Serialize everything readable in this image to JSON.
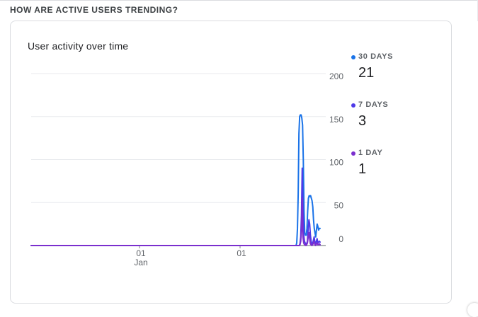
{
  "section": {
    "title": "HOW ARE ACTIVE USERS TRENDING?"
  },
  "card": {
    "title": "User activity over time"
  },
  "legend": [
    {
      "label": "30 DAYS",
      "value": "21",
      "color": "#1a73e8"
    },
    {
      "label": "7 DAYS",
      "value": "3",
      "color": "#4f3ae8"
    },
    {
      "label": "1 DAY",
      "value": "1",
      "color": "#7b2fce"
    }
  ],
  "chart_data": {
    "type": "line",
    "title": "User activity over time",
    "xlabel": "",
    "ylabel": "",
    "ylim": [
      0,
      200
    ],
    "y_ticks": [
      0,
      50,
      100,
      150,
      200
    ],
    "y_axis_side": "right",
    "grid": true,
    "legend_position": "right",
    "x_tick_labels": [
      {
        "day": "01",
        "month": "Jan"
      },
      {
        "day": "01",
        "month": ""
      }
    ],
    "series": [
      {
        "name": "30 DAYS",
        "color": "#1a73e8",
        "values": [
          0,
          0,
          0,
          0,
          0,
          0,
          0,
          0,
          0,
          0,
          0,
          0,
          0,
          0,
          0,
          0,
          0,
          0,
          0,
          0,
          0,
          0,
          0,
          0,
          0,
          0,
          0,
          0,
          0,
          0,
          0,
          0,
          0,
          0,
          0,
          0,
          0,
          0,
          0,
          0,
          0,
          0,
          0,
          0,
          0,
          0,
          0,
          0,
          0,
          0,
          0,
          0,
          0,
          0,
          0,
          0,
          0,
          0,
          0,
          0,
          0,
          0,
          0,
          0,
          0,
          0,
          0,
          0,
          0,
          0,
          0,
          0,
          0,
          0,
          0,
          0,
          0,
          0,
          0,
          0,
          0,
          0,
          0,
          0,
          0,
          0,
          0,
          0,
          0,
          0,
          0,
          0,
          0,
          0,
          0,
          0,
          0,
          0,
          0,
          0,
          0,
          0,
          0,
          0,
          0,
          0,
          0,
          0,
          0,
          0,
          0,
          0,
          0,
          0,
          0,
          0,
          0,
          0,
          0,
          0,
          0,
          0,
          0,
          0,
          0,
          0,
          0,
          0,
          0,
          0,
          0,
          0,
          0,
          0,
          0,
          0,
          0,
          0,
          0,
          0,
          0,
          0,
          0,
          0,
          0,
          0,
          0,
          0,
          0,
          0,
          0,
          0,
          0,
          0,
          0,
          0,
          0,
          0,
          0,
          0,
          0,
          0,
          0,
          0,
          0,
          0,
          0,
          0,
          0,
          0,
          0,
          0,
          0,
          0,
          0,
          0,
          0,
          0,
          0,
          0,
          0,
          0,
          0,
          0,
          0,
          0,
          0,
          0,
          0,
          0,
          0,
          0,
          0,
          0,
          0,
          0,
          0,
          0,
          0,
          0,
          0,
          0,
          0,
          0,
          0,
          0,
          0,
          0,
          0,
          0,
          0,
          0,
          0,
          0,
          0,
          0,
          0,
          0,
          0,
          0,
          0,
          0,
          0,
          0,
          0,
          0,
          0,
          0,
          0,
          0,
          0,
          0,
          0,
          0,
          0,
          0,
          0,
          0,
          0,
          0,
          0,
          0,
          0,
          0,
          0,
          0,
          0,
          0,
          0,
          0,
          0,
          0,
          0,
          0,
          0,
          0,
          0,
          0,
          0,
          0,
          0,
          0,
          0,
          0,
          0,
          0,
          0,
          0,
          0,
          0,
          0,
          0,
          0,
          0,
          0,
          0,
          0,
          0,
          0,
          0,
          0,
          0,
          0,
          0,
          0,
          0,
          0,
          0,
          0,
          0,
          0,
          0,
          0,
          0,
          0,
          0,
          0,
          0,
          0,
          0,
          0,
          0,
          0,
          0,
          0,
          0,
          0,
          0,
          0,
          0,
          0,
          0,
          0,
          0,
          0,
          0,
          0,
          0,
          0,
          0,
          0,
          0,
          0,
          0,
          0,
          0,
          0,
          0,
          0,
          0,
          0,
          0,
          0,
          0,
          0,
          0,
          0,
          0,
          0,
          0,
          0,
          0,
          0,
          0,
          0,
          0,
          0,
          0,
          0,
          0,
          0,
          0,
          0,
          0,
          0,
          0,
          0,
          0,
          0,
          0,
          0,
          0,
          0,
          0,
          3,
          20,
          60,
          130,
          150,
          152,
          152,
          148,
          140,
          100,
          40,
          15,
          12,
          12,
          20,
          40,
          55,
          58,
          57,
          58,
          55,
          52,
          45,
          30,
          20,
          15,
          10,
          18,
          25,
          22,
          18,
          20,
          20
        ]
      },
      {
        "name": "7 DAYS",
        "color": "#4f3ae8",
        "values": [
          0,
          0,
          0,
          0,
          0,
          0,
          0,
          0,
          0,
          0,
          0,
          0,
          0,
          0,
          0,
          0,
          0,
          0,
          0,
          0,
          0,
          0,
          0,
          0,
          0,
          0,
          0,
          0,
          0,
          0,
          0,
          0,
          0,
          0,
          0,
          0,
          0,
          0,
          0,
          0,
          0,
          0,
          0,
          0,
          0,
          0,
          0,
          0,
          0,
          0,
          0,
          0,
          0,
          0,
          0,
          0,
          0,
          0,
          0,
          0,
          0,
          0,
          0,
          0,
          0,
          0,
          0,
          0,
          0,
          0,
          0,
          0,
          0,
          0,
          0,
          0,
          0,
          0,
          0,
          0,
          0,
          0,
          0,
          0,
          0,
          0,
          0,
          0,
          0,
          0,
          0,
          0,
          0,
          0,
          0,
          0,
          0,
          0,
          0,
          0,
          0,
          0,
          0,
          0,
          0,
          0,
          0,
          0,
          0,
          0,
          0,
          0,
          0,
          0,
          0,
          0,
          0,
          0,
          0,
          0,
          0,
          0,
          0,
          0,
          0,
          0,
          0,
          0,
          0,
          0,
          0,
          0,
          0,
          0,
          0,
          0,
          0,
          0,
          0,
          0,
          0,
          0,
          0,
          0,
          0,
          0,
          0,
          0,
          0,
          0,
          0,
          0,
          0,
          0,
          0,
          0,
          0,
          0,
          0,
          0,
          0,
          0,
          0,
          0,
          0,
          0,
          0,
          0,
          0,
          0,
          0,
          0,
          0,
          0,
          0,
          0,
          0,
          0,
          0,
          0,
          0,
          0,
          0,
          0,
          0,
          0,
          0,
          0,
          0,
          0,
          0,
          0,
          0,
          0,
          0,
          0,
          0,
          0,
          0,
          0,
          0,
          0,
          0,
          0,
          0,
          0,
          0,
          0,
          0,
          0,
          0,
          0,
          0,
          0,
          0,
          0,
          0,
          0,
          0,
          0,
          0,
          0,
          0,
          0,
          0,
          0,
          0,
          0,
          0,
          0,
          0,
          0,
          0,
          0,
          0,
          0,
          0,
          0,
          0,
          0,
          0,
          0,
          0,
          0,
          0,
          0,
          0,
          0,
          0,
          0,
          0,
          0,
          0,
          0,
          0,
          0,
          0,
          0,
          0,
          0,
          0,
          0,
          0,
          0,
          0,
          0,
          0,
          0,
          0,
          0,
          0,
          0,
          0,
          0,
          0,
          0,
          0,
          0,
          0,
          0,
          0,
          0,
          0,
          0,
          0,
          0,
          0,
          0,
          0,
          0,
          0,
          0,
          0,
          0,
          0,
          0,
          0,
          0,
          0,
          0,
          0,
          0,
          0,
          0,
          0,
          0,
          0,
          0,
          0,
          0,
          0,
          0,
          0,
          0,
          0,
          0,
          0,
          0,
          0,
          0,
          0,
          0,
          0,
          0,
          0,
          0,
          0,
          0,
          0,
          0,
          0,
          0,
          0,
          0,
          0,
          0,
          0,
          0,
          0,
          0,
          0,
          0,
          0,
          0,
          0,
          0,
          0,
          0,
          0,
          0,
          0,
          0,
          0,
          0,
          0,
          0,
          0,
          0,
          0,
          0,
          0,
          2,
          10,
          35,
          90,
          40,
          12,
          5,
          3,
          2,
          2,
          5,
          20,
          30,
          25,
          12,
          5,
          2,
          2,
          6,
          10,
          4,
          2,
          5,
          8,
          3,
          4,
          5,
          4
        ]
      },
      {
        "name": "1 DAY",
        "color": "#7b2fce",
        "values": [
          0,
          0,
          0,
          0,
          0,
          0,
          0,
          0,
          0,
          0,
          0,
          0,
          0,
          0,
          0,
          0,
          0,
          0,
          0,
          0,
          0,
          0,
          0,
          0,
          0,
          0,
          0,
          0,
          0,
          0,
          0,
          0,
          0,
          0,
          0,
          0,
          0,
          0,
          0,
          0,
          0,
          0,
          0,
          0,
          0,
          0,
          0,
          0,
          0,
          0,
          0,
          0,
          0,
          0,
          0,
          0,
          0,
          0,
          0,
          0,
          0,
          0,
          0,
          0,
          0,
          0,
          0,
          0,
          0,
          0,
          0,
          0,
          0,
          0,
          0,
          0,
          0,
          0,
          0,
          0,
          0,
          0,
          0,
          0,
          0,
          0,
          0,
          0,
          0,
          0,
          0,
          0,
          0,
          0,
          0,
          0,
          0,
          0,
          0,
          0,
          0,
          0,
          0,
          0,
          0,
          0,
          0,
          0,
          0,
          0,
          0,
          0,
          0,
          0,
          0,
          0,
          0,
          0,
          0,
          0,
          0,
          0,
          0,
          0,
          0,
          0,
          0,
          0,
          0,
          0,
          0,
          0,
          0,
          0,
          0,
          0,
          0,
          0,
          0,
          0,
          0,
          0,
          0,
          0,
          0,
          0,
          0,
          0,
          0,
          0,
          0,
          0,
          0,
          0,
          0,
          0,
          0,
          0,
          0,
          0,
          0,
          0,
          0,
          0,
          0,
          0,
          0,
          0,
          0,
          0,
          0,
          0,
          0,
          0,
          0,
          0,
          0,
          0,
          0,
          0,
          0,
          0,
          0,
          0,
          0,
          0,
          0,
          0,
          0,
          0,
          0,
          0,
          0,
          0,
          0,
          0,
          0,
          0,
          0,
          0,
          0,
          0,
          0,
          0,
          0,
          0,
          0,
          0,
          0,
          0,
          0,
          0,
          0,
          0,
          0,
          0,
          0,
          0,
          0,
          0,
          0,
          0,
          0,
          0,
          0,
          0,
          0,
          0,
          0,
          0,
          0,
          0,
          0,
          0,
          0,
          0,
          0,
          0,
          0,
          0,
          0,
          0,
          0,
          0,
          0,
          0,
          0,
          0,
          0,
          0,
          0,
          0,
          0,
          0,
          0,
          0,
          0,
          0,
          0,
          0,
          0,
          0,
          0,
          0,
          0,
          0,
          0,
          0,
          0,
          0,
          0,
          0,
          0,
          0,
          0,
          0,
          0,
          0,
          0,
          0,
          0,
          0,
          0,
          0,
          0,
          0,
          0,
          0,
          0,
          0,
          0,
          0,
          0,
          0,
          0,
          0,
          0,
          0,
          0,
          0,
          0,
          0,
          0,
          0,
          0,
          0,
          0,
          0,
          0,
          0,
          0,
          0,
          0,
          0,
          0,
          0,
          0,
          0,
          0,
          0,
          0,
          0,
          0,
          0,
          0,
          0,
          0,
          0,
          0,
          0,
          0,
          0,
          0,
          0,
          0,
          0,
          0,
          0,
          0,
          0,
          0,
          0,
          0,
          0,
          0,
          0,
          0,
          0,
          0,
          0,
          0,
          0,
          0,
          0,
          0,
          0,
          0,
          0,
          0,
          0,
          0,
          1,
          5,
          18,
          55,
          10,
          3,
          1,
          1,
          0,
          1,
          3,
          10,
          15,
          8,
          2,
          1,
          0,
          1,
          3,
          5,
          1,
          0,
          2,
          3,
          1,
          1,
          2,
          1
        ]
      }
    ]
  }
}
